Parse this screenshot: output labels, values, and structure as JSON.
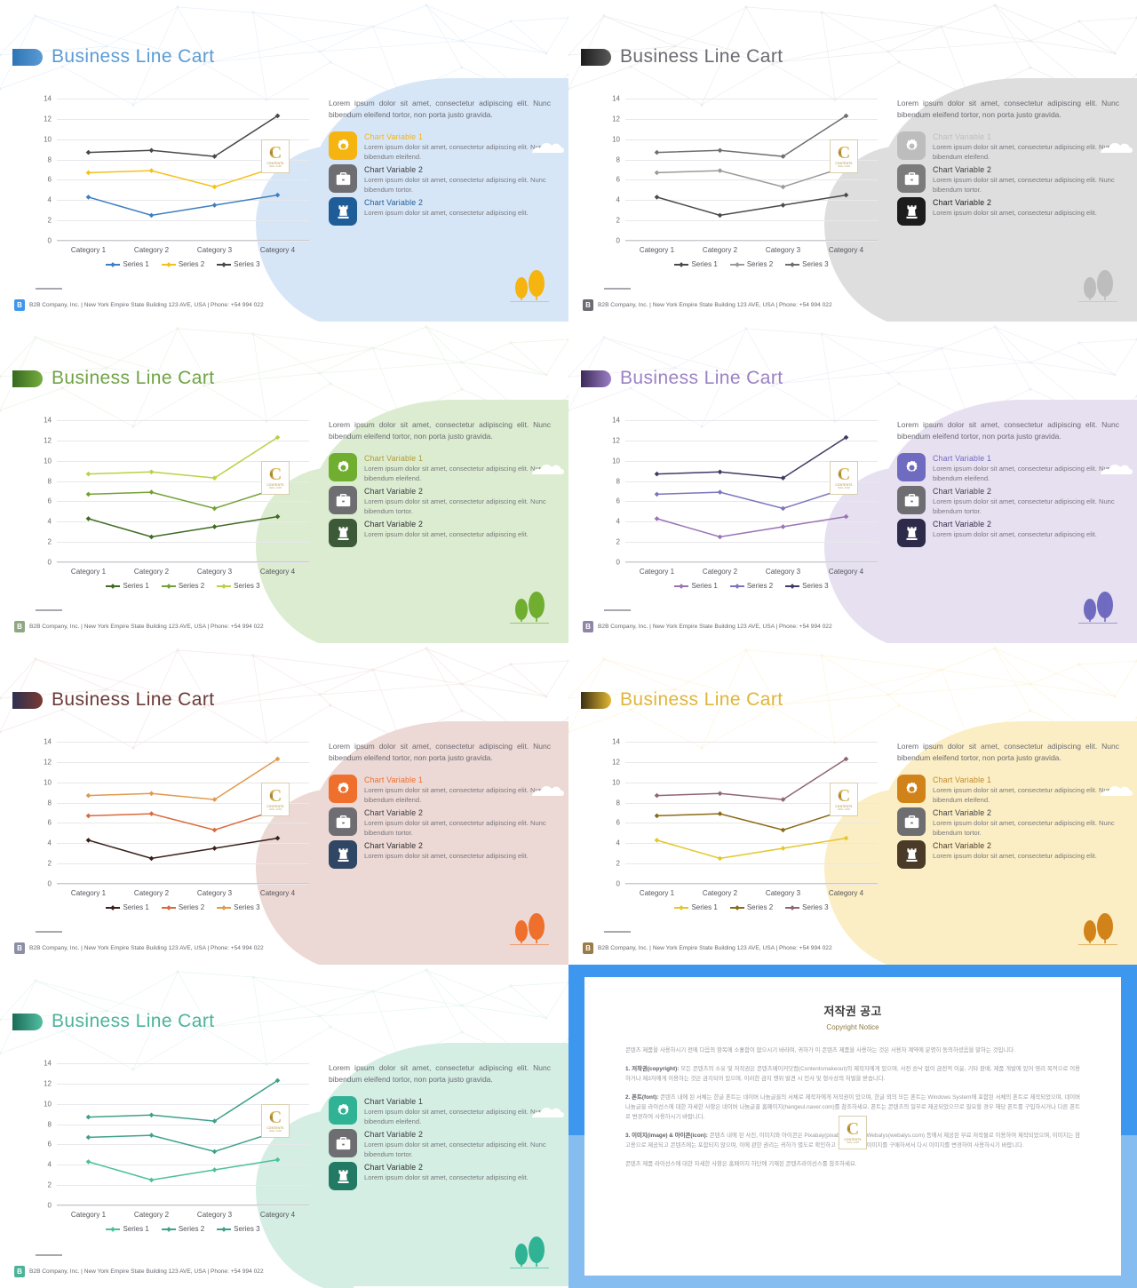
{
  "slide": {
    "title": "Business Line Cart",
    "lead_paragraph": "Lorem ipsum dolor sit amet, consectetur adipiscing elit. Nunc bibendum eleifend tortor, non porta justo gravida.",
    "features": [
      {
        "title": "Chart Variable 1",
        "body": "Lorem ipsum dolor sit amet, consectetur adipiscing elit. Nunc bibendum eleifend.",
        "icon": "gear-icon"
      },
      {
        "title": "Chart Variable 2",
        "body": "Lorem ipsum dolor sit amet, consectetur adipiscing elit. Nunc bibendum tortor.",
        "icon": "briefcase-icon"
      },
      {
        "title": "Chart Variable 2",
        "body": "Lorem ipsum dolor sit amet, consectetur adipiscing elit.",
        "icon": "chess-rook-icon"
      }
    ],
    "footer": {
      "logo_text": "B",
      "text": "B2B Company, Inc. | New York Empire State Building 123 AVE, USA | Phone: +54 994 022"
    },
    "watermark": {
      "letter": "C",
      "line1": "CONTENTS",
      "line2": "MALL.COM"
    }
  },
  "chart_data": {
    "type": "line",
    "title": "",
    "xlabel": "",
    "ylabel": "",
    "categories": [
      "Category 1",
      "Category 2",
      "Category 3",
      "Category 4"
    ],
    "yticks": [
      0,
      2,
      4,
      6,
      8,
      10,
      12,
      14
    ],
    "ylim": [
      0,
      14
    ],
    "grid": true,
    "legend": "bottom",
    "series": [
      {
        "name": "Series 1",
        "values": [
          4.3,
          2.5,
          3.5,
          4.5
        ]
      },
      {
        "name": "Series 2",
        "values": [
          6.7,
          6.9,
          5.3,
          7.3
        ]
      },
      {
        "name": "Series 3",
        "values": [
          8.7,
          8.9,
          8.3,
          12.3
        ]
      }
    ]
  },
  "themes": [
    {
      "id": "blue",
      "name": "Blue",
      "title_color": "#5b9bd5",
      "mark": "#2e74b5",
      "mark2": "#5b9bd5",
      "blob": "#d7e6f6",
      "foot_logo": "#3d97ee",
      "series": [
        "#3f7fbf",
        "#f2c21c",
        "#484848"
      ],
      "icons": [
        "#f5b40f",
        "#6e6e72",
        "#1f5d99"
      ],
      "feat_title": [
        "#f5b40f",
        "#3c3c42",
        "#1f5d99"
      ]
    },
    {
      "id": "gray",
      "name": "Gray",
      "title_color": "#6b6b72",
      "mark": "#1c1c1c",
      "mark2": "#5a5a5a",
      "blob": "#dedede",
      "foot_logo": "#6b6b72",
      "series": [
        "#4a4a4a",
        "#9a9a9a",
        "#6d6d6d"
      ],
      "icons": [
        "#bdbdbd",
        "#7b7b7b",
        "#1c1c1c"
      ],
      "feat_title": [
        "#bdbdbd",
        "#3c3c42",
        "#1c1c1c"
      ]
    },
    {
      "id": "green",
      "name": "Green",
      "title_color": "#6fa344",
      "mark": "#35691f",
      "mark2": "#77ad3e",
      "blob": "#dcecd0",
      "foot_logo": "#8fa882",
      "series": [
        "#3f6b23",
        "#74a136",
        "#bcd045"
      ],
      "icons": [
        "#6fae2f",
        "#6e6e72",
        "#3c5a38"
      ],
      "feat_title": [
        "#b09a3e",
        "#3c3c42",
        "#2f2f33"
      ]
    },
    {
      "id": "purple",
      "name": "Purple",
      "title_color": "#9b82c4",
      "mark": "#3b2a58",
      "mark2": "#9c7fc6",
      "blob": "#e7e0f0",
      "foot_logo": "#8f85a8",
      "series": [
        "#9b72b5",
        "#7a76bb",
        "#3f3a63"
      ],
      "icons": [
        "#6f6bc0",
        "#6e6e72",
        "#2e2a4a"
      ],
      "feat_title": [
        "#6f6bc0",
        "#3c3c42",
        "#2e2a4a"
      ]
    },
    {
      "id": "red",
      "name": "Red",
      "title_color": "#6b3a36",
      "mark": "#2b3050",
      "mark2": "#7a3a31",
      "blob": "#ecd8d4",
      "foot_logo": "#8b8fa3",
      "series": [
        "#3a1f1b",
        "#da6a3d",
        "#e09a4e"
      ],
      "icons": [
        "#ef6f2c",
        "#6e6e72",
        "#2f4664"
      ],
      "feat_title": [
        "#ef6f2c",
        "#3c3c42",
        "#2f2f33"
      ]
    },
    {
      "id": "gold",
      "name": "Gold",
      "title_color": "#e0b53a",
      "mark": "#3b2f12",
      "mark2": "#e3b733",
      "blob": "#fbeec4",
      "foot_logo": "#9a7c4a",
      "series": [
        "#e3c72c",
        "#8a6a16",
        "#8e6672"
      ],
      "icons": [
        "#d1831a",
        "#6e6e72",
        "#4a3a28"
      ],
      "feat_title": [
        "#c1882a",
        "#3c3c42",
        "#4a3a28"
      ]
    },
    {
      "id": "teal",
      "name": "Teal",
      "title_color": "#4cb39a",
      "mark": "#1b6b56",
      "mark2": "#52bfa3",
      "blob": "#d4eee4",
      "foot_logo": "#4cb39a",
      "series": [
        "#4cc099",
        "#3fa289",
        "#3fa08a"
      ],
      "icons": [
        "#2fb394",
        "#6e6e72",
        "#237a64"
      ],
      "feat_title": [
        "#3c3c42",
        "#3c3c42",
        "#2f2f33"
      ]
    }
  ],
  "copyright": {
    "heading_ko": "저작권 공고",
    "heading_en": "Copyright Notice",
    "paragraphs": [
      {
        "label": "",
        "text": "콘텐츠 제품을 사용하시기 전에 다음의 항목에 소홀함이 없으시기 바라며, 귀하가 이 콘텐츠 제품을 사용하는 것은 사용자 계약에 분명히 동의하셨음을 말하는 것입니다."
      },
      {
        "label": "1. 저작권(copyright):",
        "text": "모든 콘텐츠의 소유 및 저작권은 콘텐츠메이커닷컴(Contentsmakeout)의 제작자에게 있으며, 사전 승낙 없이 금전적 이윤, 기타 판매, 제품 개발에 있어 영리 목적으로 이용하거나 제3자에게 이용하는 것은 금지되어 있으며, 이러한 금지 행위 발견 시 민사 및 형사상의 처벌을 받습니다."
      },
      {
        "label": "2. 폰트(font):",
        "text": "콘텐츠 내에 된 서체는 한글 폰트는 네이버 나눔글꼴의 서체로 제작자에게 저작권이 있으며, 한글 외의 모든 폰트는 Windows System에 포함된 서체의 폰트로 제작되었으며, 네이버 나눔글꼴 라이선스에 대한 자세한 사항은 네이버 나눔글꼴 홈페이지(hangeul.naver.com)를 참조하세요. 폰트는 콘텐츠의 일부로 제공되었으므로 필요할 경우 해당 폰트를 구입하시거나 다른 폰트로 변경하여 사용하시기 바랍니다."
      },
      {
        "label": "3. 이미지(image) & 아이콘(icon):",
        "text": "콘텐츠 내에 된 사진, 이미지와 아이콘은 Pixabay(pixabay.com)와 Webalys(webalys.com) 등에서 제공된 무료 저작물로 이용하여 제작되었으며, 이미지는 참고용으로 제공되고 콘텐츠에는 포함되지 않으며, 이에 관한 권리는 귀하가 별도로 확인하고 필요할 경우 이미지를 구매하셔서 다시 이미지를 변경하여 사용하시기 바랍니다."
      },
      {
        "label": "",
        "text": "콘텐츠 제품 라이선스에 대한 자세한 사항은 홈페이지 하단에 기재된 콘텐츠라이선스를 참조하세요."
      }
    ]
  }
}
